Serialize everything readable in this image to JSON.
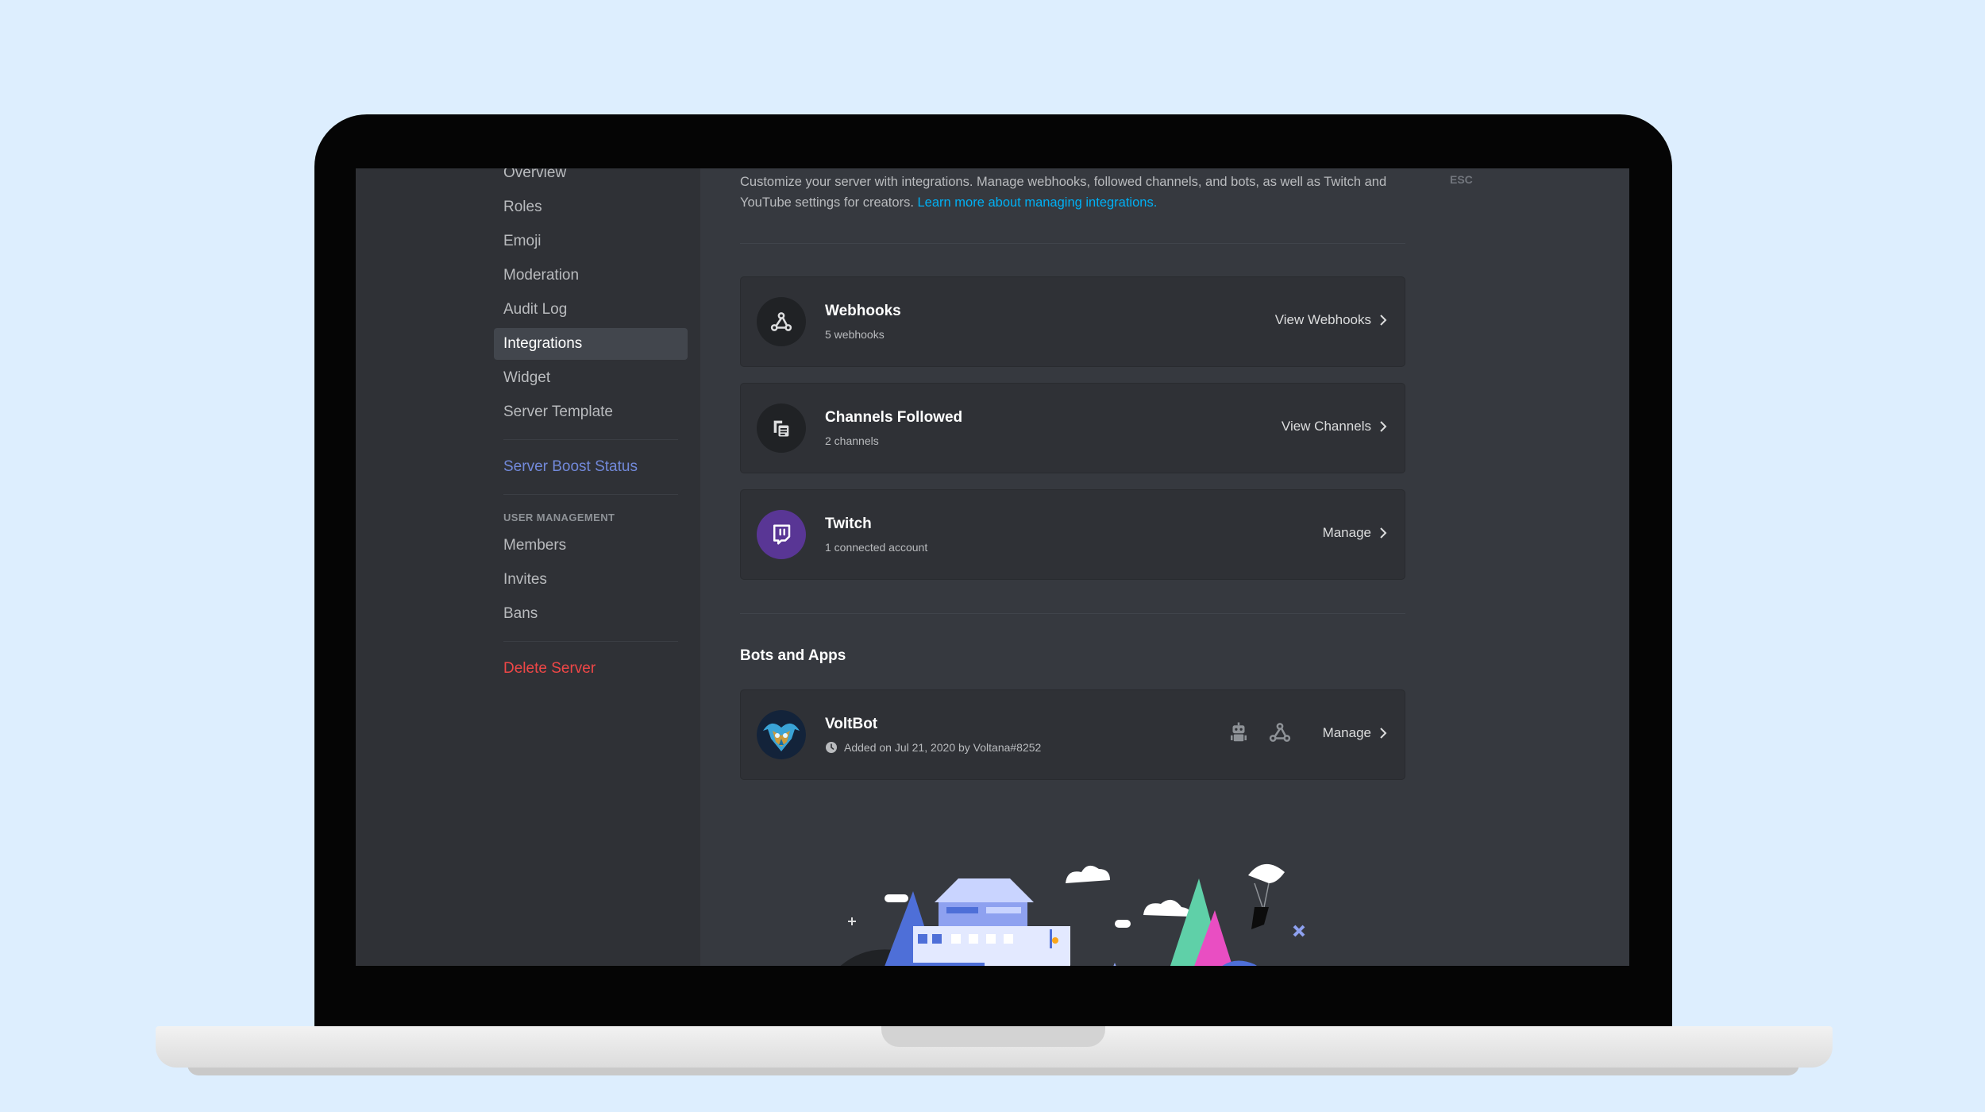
{
  "sidebar": {
    "items_top": [
      {
        "label": "Overview"
      },
      {
        "label": "Roles"
      },
      {
        "label": "Emoji"
      },
      {
        "label": "Moderation"
      },
      {
        "label": "Audit Log"
      },
      {
        "label": "Integrations"
      },
      {
        "label": "Widget"
      },
      {
        "label": "Server Template"
      }
    ],
    "boost_label": "Server Boost Status",
    "user_management_header": "USER MANAGEMENT",
    "items_users": [
      {
        "label": "Members"
      },
      {
        "label": "Invites"
      },
      {
        "label": "Bans"
      }
    ],
    "delete_label": "Delete Server"
  },
  "content": {
    "description": "Customize your server with integrations. Manage webhooks, followed channels, and bots, as well as Twitch and YouTube settings for creators.",
    "learn_more": "Learn more about managing integrations.",
    "esc_label": "ESC",
    "cards": [
      {
        "title": "Webhooks",
        "subtitle": "5 webhooks",
        "action": "View Webhooks"
      },
      {
        "title": "Channels Followed",
        "subtitle": "2 channels",
        "action": "View Channels"
      },
      {
        "title": "Twitch",
        "subtitle": "1 connected account",
        "action": "Manage"
      }
    ],
    "bots_section_title": "Bots and Apps",
    "bot": {
      "name": "VoltBot",
      "added": "Added on Jul 21, 2020 by Voltana#8252",
      "action": "Manage"
    }
  },
  "colors": {
    "accent": "#7289da",
    "danger": "#f04747",
    "link": "#00b0f4",
    "twitch": "#593695"
  }
}
